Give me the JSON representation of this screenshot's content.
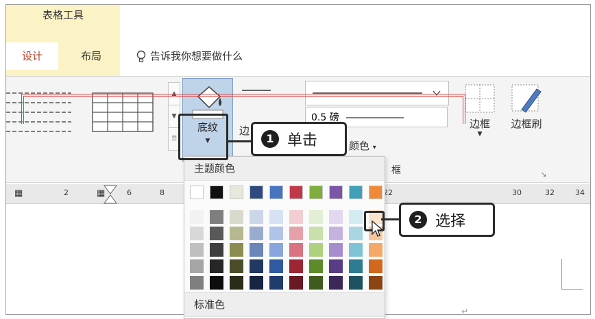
{
  "context_tab_group": "表格工具",
  "tabs": [
    {
      "label": "设计"
    },
    {
      "label": "布局"
    }
  ],
  "tell_me": "告诉我你想要做什么",
  "ribbon": {
    "shading_label": "底纹",
    "border_styles_partial": "边",
    "line_weight": "0.5 磅",
    "pen_color": "颜色",
    "group_label_borders": "框",
    "borders_button": "边框",
    "border_painter_button": "边框刷"
  },
  "ruler": {
    "labels": [
      "2",
      "6",
      "8",
      "22",
      "30",
      "32",
      "34"
    ]
  },
  "dropdown": {
    "theme_colors_label": "主题颜色",
    "standard_colors_label": "标准色",
    "theme_base": [
      "#ffffff",
      "#111111",
      "#e6e8dc",
      "#2e4a7e",
      "#4774c0",
      "#c0394a",
      "#7fae3e",
      "#7b55a8",
      "#3fa0b8",
      "#ef8a3a"
    ],
    "tints": [
      [
        "#f2f2f2",
        "#7f7f7f",
        "#d8dacb",
        "#cbd6e8",
        "#d6e1f3",
        "#f2ced3",
        "#e3efd4",
        "#e2d8ef",
        "#d3ebf1",
        "#fbe2cd"
      ],
      [
        "#d8d8d8",
        "#595959",
        "#b6b98f",
        "#98acd0",
        "#afc4e8",
        "#e6a0a9",
        "#c8e0aa",
        "#c4b2df",
        "#a8d7e3",
        "#f8c59c"
      ],
      [
        "#bfbfbf",
        "#3f3f3f",
        "#8a8d4f",
        "#6a85b8",
        "#88a6dd",
        "#d97382",
        "#aed17f",
        "#a78cce",
        "#7ec4d5",
        "#f4a86a"
      ],
      [
        "#a5a5a5",
        "#262626",
        "#4b4d2a",
        "#213863",
        "#2f5aa0",
        "#9c2634",
        "#5e8b2a",
        "#5a3c85",
        "#2d7c90",
        "#d0681d"
      ],
      [
        "#7f7f7f",
        "#0d0d0d",
        "#2b2c18",
        "#152542",
        "#1f3c6a",
        "#681923",
        "#3f5c1c",
        "#3c2858",
        "#1e5260",
        "#8a4513"
      ]
    ]
  },
  "callouts": {
    "step1_number": "1",
    "step1_text": "单击",
    "step2_number": "2",
    "step2_text": "选择"
  }
}
